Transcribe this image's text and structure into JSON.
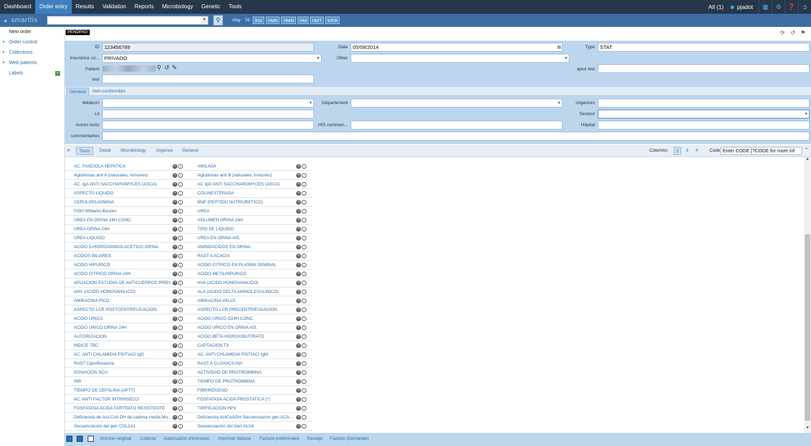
{
  "topnav": {
    "items": [
      "Dashboard",
      "Order entry",
      "Results",
      "Validation",
      "Reports",
      "Microbiology",
      "Genetic",
      "Tools"
    ],
    "active_index": 1,
    "all_label": "All (1)",
    "user": "pjadot"
  },
  "subbar": {
    "logo": "smartlis",
    "filters": [
      "Hoy",
      "7d",
      "30d",
      "HMN",
      "HMM",
      "HM",
      "HMT",
      "WEB"
    ]
  },
  "sidebar": {
    "items": [
      {
        "label": "New order"
      },
      {
        "label": "Order control"
      },
      {
        "label": "Collections"
      },
      {
        "label": "Web patients"
      },
      {
        "label": "Labels"
      }
    ]
  },
  "order": {
    "status_badge": "PENDPAG",
    "id_label": "ID",
    "id_value": "123456789",
    "date_label": "Date",
    "date_value": "05/08/2014",
    "type_label": "Type",
    "type_value": "STAT",
    "insurance_label": "Insurance co...",
    "insurance_value": "PRIVADO",
    "other_label": "Other",
    "patient_label": "Patient",
    "ajout_label": "ajout test",
    "test_label": "test"
  },
  "tabs": {
    "form_tabs": [
      "Général",
      "Non-conformités"
    ],
    "general": {
      "medecin": "Médecin",
      "departement": "Département",
      "urgences": "Urgences",
      "lit": "Lit",
      "secteur": "Secteur",
      "autres_tests": "Autres tests",
      "his_comment": "HIS commen...",
      "hopital": "Hôpital",
      "commentaires": "commentaires"
    }
  },
  "tests_bar": {
    "tabs": [
      "Tests",
      "Detail",
      "Microbiology",
      "Urgence",
      "General"
    ],
    "columns_label": "Columns:",
    "columns": [
      "2",
      "3",
      "4"
    ],
    "code_label": "Code",
    "code_placeholder": "Enter CODE [?CODE for more inf"
  },
  "tests": {
    "col1": [
      "AC. FASCIOLA HEPATICA",
      "Aglutininas anti A (naturales, inmunes)",
      "AC. IgA ANTI SACCHAROMYCES (ASCA)",
      "ASPECTO LIQUIDO",
      "CERULOPLASMINA",
      "FISH Williams-Beuren",
      "UREA EN ORINA 24H CONC.",
      "UREA ORINA 24H",
      "UREA LIQUIDO",
      "ACIDO 5-HIDROXIINDOLACETICO ORINA",
      "ACIDOS BILIARES",
      "ACIDO HIPURICO",
      "ACIDO CITRICO ORINA 24H",
      "APLIACION ESTUDIO DE ANTICUERPOS IRREG...",
      "AHV (ACIDO HOMOVANILICO)",
      "AMIKACINA PICO",
      "ASPECTO LCR POSTCENTRIFUGACION",
      "ACIDO URICO",
      "ACIDO URICO ORINA 24H",
      "AUTORIZACION",
      "INDICE TBC",
      "AC. ANTI CHLAMIDIA PSITIACI IgG",
      "RAST Ciprofloxacina",
      "DONACION SCU",
      "INR",
      "TIEMPO DE CEFALINA (APTT)",
      "AC. ANTI FACTOR INTRINSECO",
      "FOSFATASA ACIDA TARTRATO RESISTENTE",
      "Deficiencia de Acil.CoA DH de cadena media.Mu...",
      "Secuenciación del gen COL2A1"
    ],
    "col2": [
      "AMILASA",
      "Aglutininas anti B (naturales, inmunes)",
      "AC IgG ANTI SACCHAROMYCES (ASCA)",
      "COLINESTERASA",
      "BNP (PEPTIDO NATRIURETICO)",
      "UREA",
      "VOLUMEN ORINA 24H",
      "TIPO DE LIQUIDO",
      "UREA EN ORINA AIS.",
      "AMINOACIDOS EN ORINA",
      "RAST A ACACIA",
      "ACIDO CITRICO EN PLASMA SEMINAL",
      "ACIDO METILHIPURICO",
      "HVA (ACIDO HOMOVANILICO)",
      "ALA (ACIDO DELTA AMINOLEVULINICO)",
      "AMIKACINA VALLE",
      "ASPECTO LCR PRECENTRIFUGACION",
      "ACIDO URICO O24H CONC.",
      "ACIDO URICO EN ORINA AIS.",
      "ACIDO BETA HIDROXIBUTIRATO",
      "CAPTACION T3",
      "AC. ANTI CHLAMIDIA PSITIACI IgM",
      "RAST A CLOXACILINA",
      "ACTIVIDAD DE PROTROMBINA",
      "TIEMPO DE PROTROMBINA",
      "FIBRINÓGENO",
      "FOSFATASA ACIDA PROSTATICA (*)",
      "TIPIFICACION HPV",
      "Deficiencia AcilCoADH.Secuenciacion gen ACA...",
      "Secuenciación del Gen ALX4"
    ]
  },
  "footer": {
    "buttons": [
      "montrer original",
      "Collecte",
      "Autorisation d'émission",
      "Imprimer facture",
      "Facture préliminaire",
      "Receipt",
      "Facture (Demande)"
    ]
  }
}
